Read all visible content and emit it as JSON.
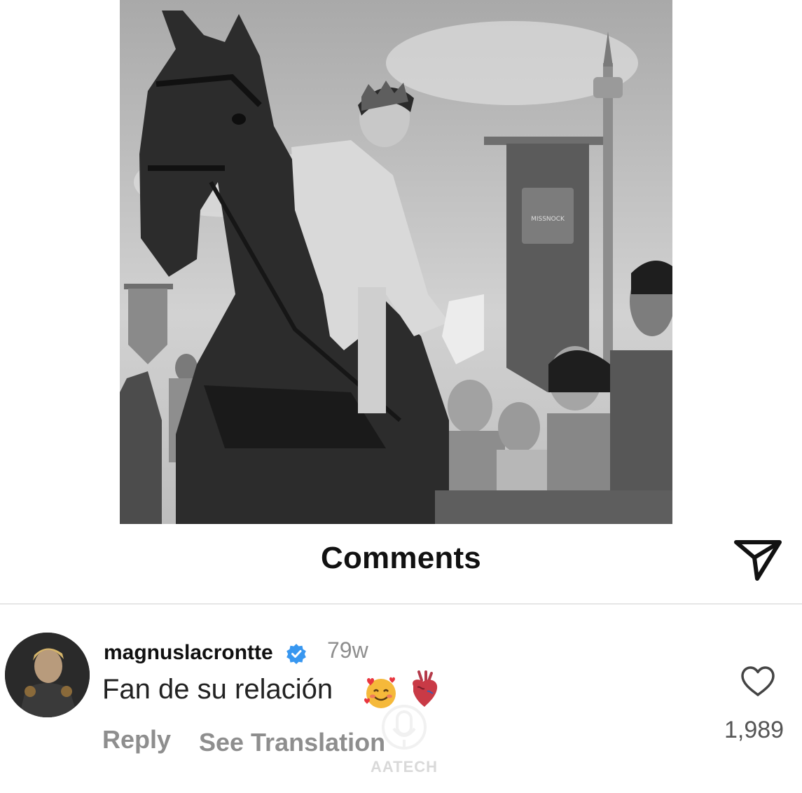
{
  "post": {
    "image_description_icon": "illustration-image",
    "banner_text": "MISSNOCK"
  },
  "comments_header": {
    "title": "Comments",
    "share_icon": "paper-plane-icon"
  },
  "comment": {
    "username": "magnuslacrontte",
    "verified_icon": "verified-badge-icon",
    "timestamp": "79w",
    "text": "Fan de su relación",
    "emojis": [
      "smiling-face-with-hearts-emoji",
      "anatomical-heart-emoji"
    ],
    "reply_label": "Reply",
    "see_translation_label": "See Translation",
    "like_icon": "heart-outline-icon",
    "like_count": "1,989"
  },
  "watermark": {
    "text": "AATECH"
  },
  "colors": {
    "verified_blue": "#3897f0",
    "secondary_text": "#8e8e8e",
    "divider": "#e6e6e6"
  }
}
